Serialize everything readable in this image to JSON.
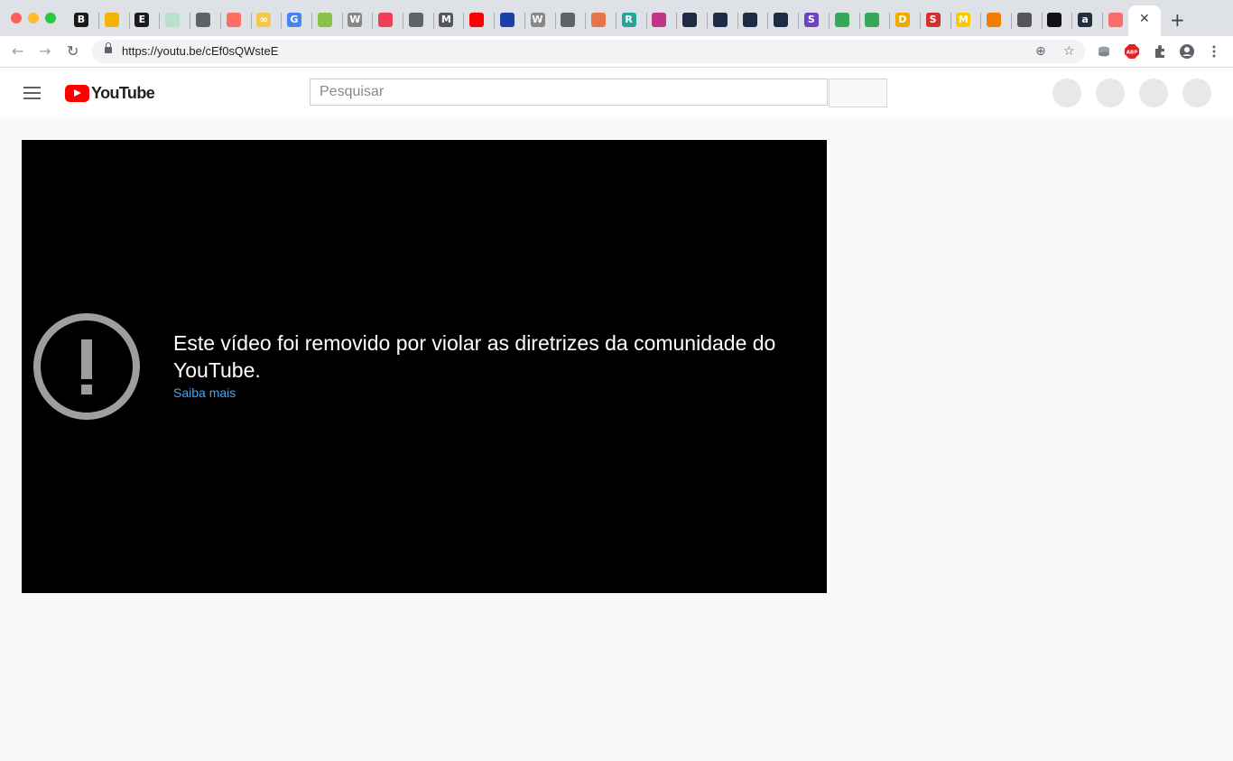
{
  "browser": {
    "url": "https://youtu.be/cEf0sQWsteE",
    "close_tab_glyph": "✕",
    "new_tab_glyph": "+",
    "tab_favicons": [
      {
        "icon": "b-icon",
        "char": "B",
        "bg": "#1a1a1a"
      },
      {
        "icon": "slides-icon",
        "char": "",
        "bg": "#f4b400"
      },
      {
        "icon": "e-icon",
        "char": "E",
        "bg": "#1a1a1a"
      },
      {
        "icon": "sheet-icon",
        "char": "",
        "bg": "#b7e1cd"
      },
      {
        "icon": "globe-icon",
        "char": "",
        "bg": "#5f6368"
      },
      {
        "icon": "ring-icon",
        "char": "",
        "bg": "#ff6f61"
      },
      {
        "icon": "infinity-icon",
        "char": "∞",
        "bg": "#f2c94c"
      },
      {
        "icon": "google-icon",
        "char": "G",
        "bg": "#4285f4"
      },
      {
        "icon": "shop-icon",
        "char": "",
        "bg": "#8bc34a"
      },
      {
        "icon": "wikipedia-icon",
        "char": "W",
        "bg": "#888888"
      },
      {
        "icon": "pocket-icon",
        "char": "",
        "bg": "#ef4056"
      },
      {
        "icon": "globe-icon",
        "char": "",
        "bg": "#5f6368"
      },
      {
        "icon": "medium-icon",
        "char": "M",
        "bg": "#555555"
      },
      {
        "icon": "youtube-icon",
        "char": "",
        "bg": "#ff0000"
      },
      {
        "icon": "sphere-icon",
        "char": "",
        "bg": "#1a3fa8"
      },
      {
        "icon": "wikipedia-icon",
        "char": "W",
        "bg": "#888888"
      },
      {
        "icon": "globe-icon",
        "char": "",
        "bg": "#5f6368"
      },
      {
        "icon": "book-icon",
        "char": "",
        "bg": "#e8734a"
      },
      {
        "icon": "r-icon",
        "char": "R",
        "bg": "#26a69a"
      },
      {
        "icon": "instagram-icon",
        "char": "",
        "bg": "#c13584"
      },
      {
        "icon": "mountain-icon",
        "char": "",
        "bg": "#1f2a44"
      },
      {
        "icon": "mountain-icon",
        "char": "",
        "bg": "#1f2a44"
      },
      {
        "icon": "mountain-icon",
        "char": "",
        "bg": "#1f2a44"
      },
      {
        "icon": "mountain-icon",
        "char": "",
        "bg": "#1f2a44"
      },
      {
        "icon": "s-icon",
        "char": "S",
        "bg": "#6f42c1"
      },
      {
        "icon": "drive-icon",
        "char": "",
        "bg": "#34a853"
      },
      {
        "icon": "drive-icon",
        "char": "",
        "bg": "#34a853"
      },
      {
        "icon": "d-icon",
        "char": "D",
        "bg": "#f2a900"
      },
      {
        "icon": "s-icon",
        "char": "S",
        "bg": "#d32f2f"
      },
      {
        "icon": "m-icon",
        "char": "M",
        "bg": "#f9c900"
      },
      {
        "icon": "grid-icon",
        "char": "",
        "bg": "#f57c00"
      },
      {
        "icon": "arrow-icon",
        "char": "",
        "bg": "#555555"
      },
      {
        "icon": "dark-icon",
        "char": "",
        "bg": "#111111"
      },
      {
        "icon": "amazon-icon",
        "char": "a",
        "bg": "#232f3e"
      },
      {
        "icon": "target-icon",
        "char": "",
        "bg": "#ff6b6b"
      }
    ]
  },
  "header": {
    "logo_text": "YouTube",
    "search_placeholder": "Pesquisar"
  },
  "player": {
    "message": "Este vídeo foi removido por violar as diretrizes da comunidade do YouTube.",
    "learn_more": "Saiba mais",
    "icon": "warning-icon",
    "icon_color": "#9e9e9e",
    "link_color": "#3ea6ff"
  }
}
